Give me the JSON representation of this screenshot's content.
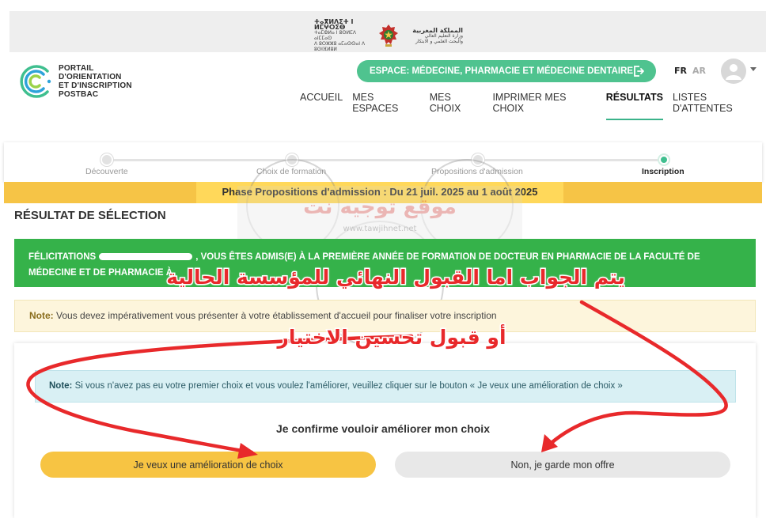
{
  "gov": {
    "left_line1": "ⵜⴰⴳⵍⴷⵉⵜ ⵏ ⵍⵎⵖⵔⵉⴱ",
    "left_line2": "ⵜⴰⵎⵀⵍⴰ ⵏ ⵓⵙⵍⵎⴷ ⴰⵏⵎⵎⴰⵙ",
    "left_line3": "ⴷ ⵓⵔⵣⵣⵓ ⴰⵎⴰⵙⵙⴰⵏ ⴷ ⵓⵙⵏⴼⵍⵓⵍ",
    "right_line1": "المملكة المغربية",
    "right_line2": "وزارة التعليم العالي",
    "right_line3": "والبحث العلمي و الابتكار"
  },
  "brand": {
    "line1": "PORTAIL",
    "line2": "D'ORIENTATION",
    "line3": "ET D'INSCRIPTION",
    "line4": "POSTBAC"
  },
  "header": {
    "espace_label": "ESPACE: MÉDECINE, PHARMACIE ET MÉDECINE DENTAIRE",
    "lang_fr": "FR",
    "lang_ar": "AR"
  },
  "nav": [
    {
      "label": "ACCUEIL"
    },
    {
      "label": "MES ESPACES"
    },
    {
      "label": "MES CHOIX"
    },
    {
      "label": "IMPRIMER MES CHOIX"
    },
    {
      "label": "RÉSULTATS"
    },
    {
      "label": "LISTES D'ATTENTES"
    }
  ],
  "steps": [
    {
      "label": "Découverte"
    },
    {
      "label": "Choix de formation"
    },
    {
      "label": "Propositions d'admission"
    },
    {
      "label": "Inscription"
    }
  ],
  "phase": "Phase Propositions d'admission : Du 21 juil. 2025 au 1 août 2025",
  "result": {
    "title": "RÉSULTAT DE SÉLECTION",
    "congrats_prefix": "FÉLICITATIONS",
    "congrats_rest": ", VOUS ÊTES ADMIS(E) À LA PREMIÈRE ANNÉE DE FORMATION DE DOCTEUR EN PHARMACIE DE LA FACULTÉ DE MÉDECINE ET DE PHARMACIE À"
  },
  "note1": {
    "label": "Note:",
    "text": " Vous devez impérativement vous présenter à votre établissement d'accueil pour finaliser votre inscription"
  },
  "note2": {
    "label": "Note:",
    "text": " Si vous n'avez pas eu votre premier choix et vous voulez l'améliorer, veuillez cliquer sur le bouton « Je veux une amélioration de choix »"
  },
  "confirm": {
    "title": "Je confirme vouloir améliorer mon choix",
    "improve_label": "Je veux une amélioration de choix",
    "keep_label": "Non, je garde mon offre"
  },
  "watermark": {
    "line1": "موقع توجيه نت",
    "line2": "www.tawjihnet.net"
  },
  "annotation": {
    "line1": "يتم الجواب اما القبول النهائي للمؤسسة الحالية",
    "line2": "أو قبول تحسين الاختيار"
  },
  "colors": {
    "accent_green": "#4fc38f",
    "success_green": "#35b24a",
    "phase_yellow": "#f6c446",
    "button_yellow": "#f7c443",
    "annotation_red": "#e8292b"
  }
}
